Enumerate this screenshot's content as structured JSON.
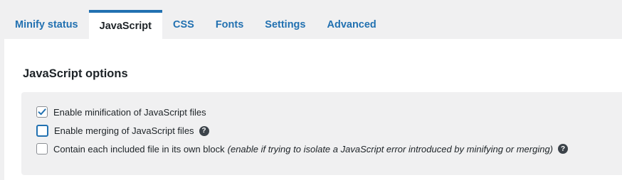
{
  "tabs": [
    {
      "label": "Minify status",
      "active": false
    },
    {
      "label": "JavaScript",
      "active": true
    },
    {
      "label": "CSS",
      "active": false
    },
    {
      "label": "Fonts",
      "active": false
    },
    {
      "label": "Settings",
      "active": false
    },
    {
      "label": "Advanced",
      "active": false
    }
  ],
  "section": {
    "title": "JavaScript options"
  },
  "options": [
    {
      "label": "Enable minification of JavaScript files",
      "checked": true,
      "focused": false,
      "hint": "",
      "help": false
    },
    {
      "label": "Enable merging of JavaScript files",
      "checked": false,
      "focused": true,
      "hint": "",
      "help": true
    },
    {
      "label": "Contain each included file in its own block",
      "checked": false,
      "focused": false,
      "hint": "(enable if trying to isolate a JavaScript error introduced by minifying or merging)",
      "help": true
    }
  ],
  "icons": {
    "help": "question-mark-circle-icon",
    "check": "checkmark-icon"
  },
  "colors": {
    "accent": "#2271b1",
    "text": "#1d2327",
    "page_bg": "#f0f0f1",
    "panel_bg": "#ffffff"
  }
}
